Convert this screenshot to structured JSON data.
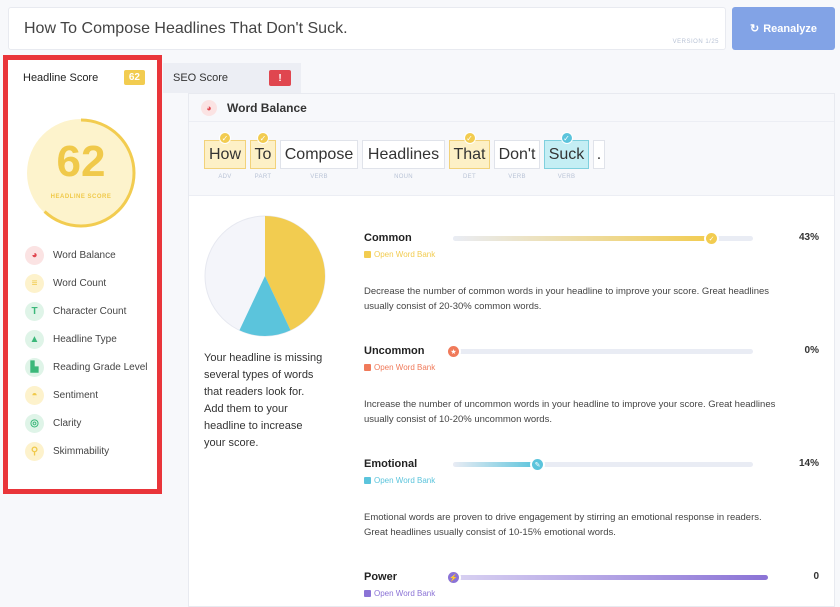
{
  "headline_input": {
    "value": "How To Compose Headlines That Don't Suck.",
    "version": "VERSION 1/25"
  },
  "reanalyze_label": "Reanalyze",
  "tabs": {
    "headline_score": {
      "label": "Headline Score",
      "badge": "62"
    },
    "seo_score": {
      "label": "SEO Score",
      "badge": "!"
    }
  },
  "score": {
    "value": "62",
    "label": "HEADLINE SCORE",
    "fraction": 0.62,
    "color": "#f2cc50"
  },
  "nav": [
    {
      "label": "Word Balance",
      "icon": "pie-chart-icon",
      "color": "#e0464f",
      "bg": "#fbe3e3",
      "glyph": "◕"
    },
    {
      "label": "Word Count",
      "icon": "lines-icon",
      "color": "#f0c94a",
      "bg": "#fdf2cc",
      "glyph": "≡"
    },
    {
      "label": "Character Count",
      "icon": "text-t-icon",
      "color": "#3bb87a",
      "bg": "#dff4e8",
      "glyph": "T"
    },
    {
      "label": "Headline Type",
      "icon": "shapes-icon",
      "color": "#3bb87a",
      "bg": "#dff4e8",
      "glyph": "▲"
    },
    {
      "label": "Reading Grade Level",
      "icon": "book-icon",
      "color": "#3bb87a",
      "bg": "#dff4e8",
      "glyph": "▙"
    },
    {
      "label": "Sentiment",
      "icon": "smile-icon",
      "color": "#f0c94a",
      "bg": "#fdf2cc",
      "glyph": "◓"
    },
    {
      "label": "Clarity",
      "icon": "target-icon",
      "color": "#3bb87a",
      "bg": "#dff4e8",
      "glyph": "◎"
    },
    {
      "label": "Skimmability",
      "icon": "magnifier-icon",
      "color": "#f0c94a",
      "bg": "#fdf2cc",
      "glyph": "⚲"
    }
  ],
  "word_balance": {
    "title": "Word Balance",
    "words": [
      {
        "text": "How",
        "pos": "ADV",
        "type": "common"
      },
      {
        "text": "To",
        "pos": "PART",
        "type": "common"
      },
      {
        "text": "Compose",
        "pos": "VERB",
        "type": "none"
      },
      {
        "text": "Headlines",
        "pos": "NOUN",
        "type": "none"
      },
      {
        "text": "That",
        "pos": "DET",
        "type": "common"
      },
      {
        "text": "Don't",
        "pos": "VERB",
        "type": "none"
      },
      {
        "text": "Suck",
        "pos": "VERB",
        "type": "emotional"
      },
      {
        "text": ".",
        "pos": "",
        "type": "none"
      }
    ],
    "summary": "Your headline is missing several types of words that readers look for. Add them to your headline to increase your score.",
    "categories": [
      {
        "name": "Common",
        "percent": 43,
        "pct_label": "43%",
        "color": "#f2cc50",
        "bank": "Open Word Bank",
        "desc": "Decrease the number of common words in your headline to improve your score. Great headlines usually consist of 20-30% common words."
      },
      {
        "name": "Uncommon",
        "percent": 0,
        "pct_label": "0%",
        "color": "#f07a5a",
        "bank": "Open Word Bank",
        "desc": "Increase the number of uncommon words in your headline to improve your score. Great headlines usually consist of 10-20% uncommon words."
      },
      {
        "name": "Emotional",
        "percent": 14,
        "pct_label": "14%",
        "color": "#5bc4dc",
        "bank": "Open Word Bank",
        "desc": "Emotional words are proven to drive engagement by stirring an emotional response in readers. Great headlines usually consist of 10-15% emotional words."
      },
      {
        "name": "Power",
        "percent": 0,
        "pct_label": "0",
        "color": "#8b73d6",
        "bank": "Open Word Bank",
        "desc": ""
      }
    ]
  }
}
